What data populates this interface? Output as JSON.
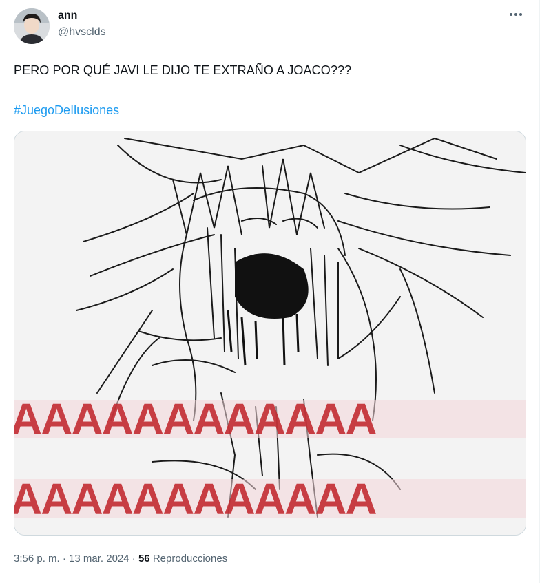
{
  "author": {
    "display_name": "ann",
    "handle": "@hvsclds"
  },
  "tweet": {
    "text": "PERO POR QUÉ JAVI LE DIJO TE EXTRAÑO A JOACO???",
    "hashtag": "#JuegoDeIlusiones"
  },
  "media": {
    "scream_text_line1": "AAAAAAAAAAAA",
    "scream_text_line2": "AAAAAAAAAAAA",
    "accent_color": "#c1272d"
  },
  "meta": {
    "time": "3:56 p. m.",
    "separator": "·",
    "date": "13 mar. 2024",
    "views_count": "56",
    "views_label": "Reproducciones"
  },
  "icons": {
    "more": "more-horizontal-icon"
  },
  "colors": {
    "link": "#1d9bf0",
    "secondary_text": "#536471",
    "primary_text": "#0f1419"
  }
}
